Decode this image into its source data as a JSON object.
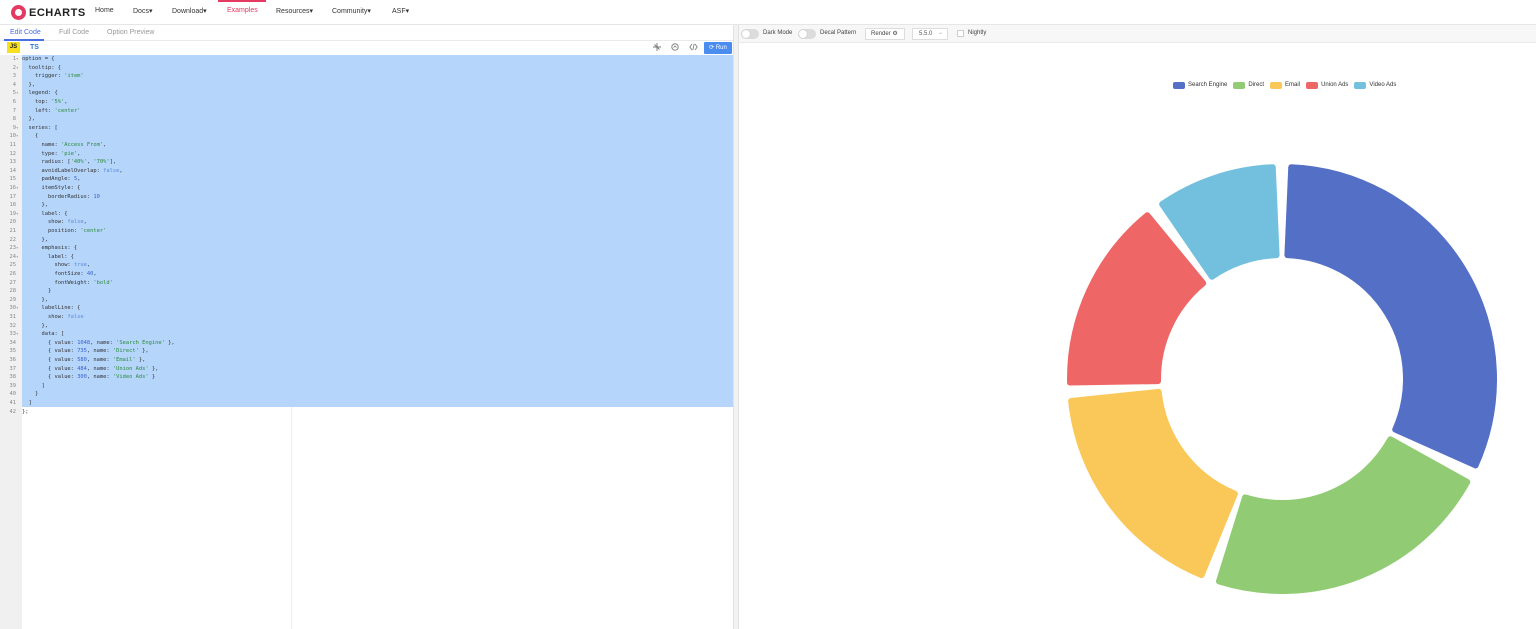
{
  "navbar": {
    "brand": "ECHARTS",
    "items": [
      {
        "label": "Home"
      },
      {
        "label": "Docs▾"
      },
      {
        "label": "Download▾"
      },
      {
        "label": "Examples"
      },
      {
        "label": "Resources▾"
      },
      {
        "label": "Community▾"
      },
      {
        "label": "ASF▾"
      }
    ],
    "active_item": "Examples",
    "accent_color": "#e43961"
  },
  "editor": {
    "tabs": [
      {
        "label": "Edit Code"
      },
      {
        "label": "Full Code"
      },
      {
        "label": "Option Preview"
      }
    ],
    "active_tab": "Edit Code",
    "lang_js": "JS",
    "lang_ts": "TS",
    "run_label": "⟳ Run",
    "code_lines": [
      "option = {",
      "  tooltip: {",
      "    trigger: 'item'",
      "  },",
      "  legend: {",
      "    top: '5%',",
      "    left: 'center'",
      "  },",
      "  series: [",
      "    {",
      "      name: 'Access From',",
      "      type: 'pie',",
      "      radius: ['40%', '70%'],",
      "      avoidLabelOverlap: false,",
      "      padAngle: 5,",
      "      itemStyle: {",
      "        borderRadius: 10",
      "      },",
      "      label: {",
      "        show: false,",
      "        position: 'center'",
      "      },",
      "      emphasis: {",
      "        label: {",
      "          show: true,",
      "          fontSize: 40,",
      "          fontWeight: 'bold'",
      "        }",
      "      },",
      "      labelLine: {",
      "        show: false",
      "      },",
      "      data: [",
      "        { value: 1048, name: 'Search Engine' },",
      "        { value: 735, name: 'Direct' },",
      "        { value: 580, name: 'Email' },",
      "        { value: 484, name: 'Union Ads' },",
      "        { value: 300, name: 'Video Ads' }",
      "      ]",
      "    }",
      "  ]",
      "};"
    ],
    "foldable_lines": [
      1,
      2,
      5,
      9,
      10,
      16,
      19,
      23,
      24,
      30,
      33
    ]
  },
  "toolbar": {
    "dark_mode_label": "Dark Mode",
    "decal_label": "Decal Pattern",
    "render_label": "Render ⚙",
    "version": "5.5.0",
    "version_caret": "⌄",
    "nightly_label": "Nightly"
  },
  "chart_data": {
    "type": "pie",
    "donut": true,
    "legend_position": "top-center",
    "series_name": "Access From",
    "slices": [
      {
        "name": "Search Engine",
        "value": 1048,
        "color": "#5470c6"
      },
      {
        "name": "Direct",
        "value": 735,
        "color": "#91cc75"
      },
      {
        "name": "Email",
        "value": 580,
        "color": "#fac858"
      },
      {
        "name": "Union Ads",
        "value": 484,
        "color": "#ee6666"
      },
      {
        "name": "Video Ads",
        "value": 300,
        "color": "#73c0de"
      }
    ]
  }
}
